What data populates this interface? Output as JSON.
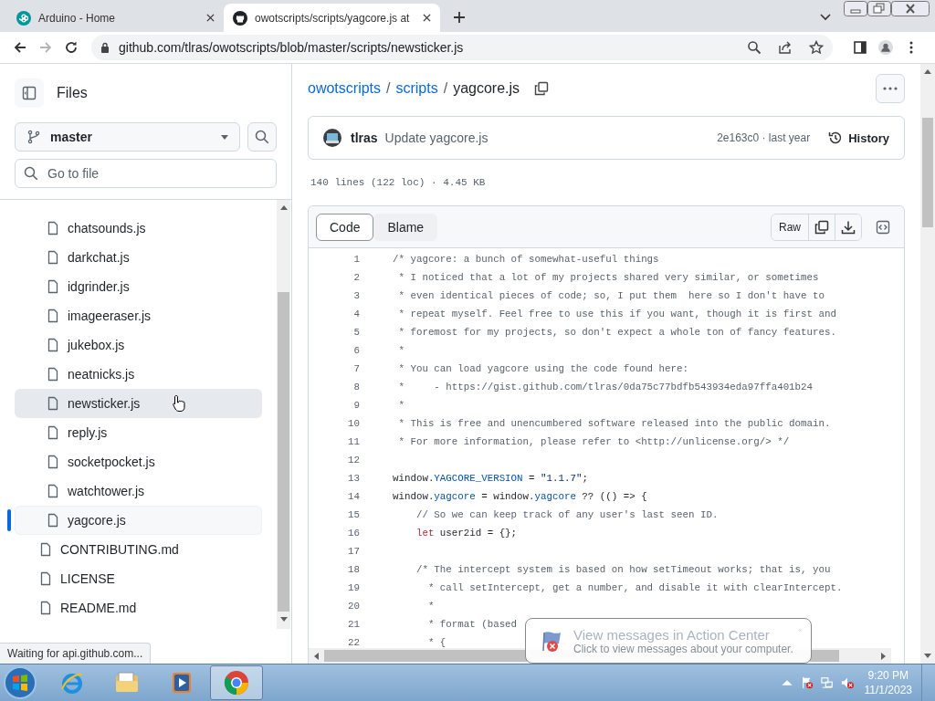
{
  "browser_tabs": [
    {
      "title": "Arduino - Home",
      "kind": "arduino",
      "selected": false
    },
    {
      "title": "owotscripts/scripts/yagcore.js at",
      "kind": "github",
      "selected": true
    }
  ],
  "address_bar": {
    "url": "github.com/tlras/owotscripts/blob/master/scripts/newsticker.js",
    "forward_disabled": true
  },
  "sidebar": {
    "title": "Files",
    "branch": "master",
    "search_placeholder": "Go to file",
    "file_tree": [
      {
        "children": [
          {
            "name": "chatsounds.js",
            "selected": false,
            "hovered": false
          },
          {
            "name": "darkchat.js",
            "selected": false,
            "hovered": false
          },
          {
            "name": "idgrinder.js",
            "selected": false,
            "hovered": false
          },
          {
            "name": "imageeraser.js",
            "selected": false,
            "hovered": false
          },
          {
            "name": "jukebox.js",
            "selected": false,
            "hovered": false
          },
          {
            "name": "neatnicks.js",
            "selected": false,
            "hovered": false
          },
          {
            "name": "newsticker.js",
            "selected": false,
            "hovered": true
          },
          {
            "name": "reply.js",
            "selected": false,
            "hovered": false
          },
          {
            "name": "socketpocket.js",
            "selected": false,
            "hovered": false
          },
          {
            "name": "watchtower.js",
            "selected": false,
            "hovered": false
          },
          {
            "name": "yagcore.js",
            "selected": true,
            "hovered": false
          }
        ]
      },
      {
        "name": "CONTRIBUTING.md",
        "selected": false,
        "hovered": false
      },
      {
        "name": "LICENSE",
        "selected": false,
        "hovered": false
      },
      {
        "name": "README.md",
        "selected": false,
        "hovered": false
      }
    ]
  },
  "breadcrumb": [
    {
      "text": "owotscripts",
      "kind": "link"
    },
    {
      "text": "/",
      "kind": "separator"
    },
    {
      "text": "scripts",
      "kind": "link"
    },
    {
      "text": "/",
      "kind": "separator"
    },
    {
      "text": "yagcore.js",
      "kind": "current"
    }
  ],
  "commit": {
    "author": "tlras",
    "message": "Update yagcore.js",
    "meta": "2e163c0 · last year",
    "history_label": "History"
  },
  "file_info": "140 lines (122 loc) · 4.45 KB",
  "view_tabs": [
    {
      "label": "Code",
      "selected": true
    },
    {
      "label": "Blame",
      "selected": false
    }
  ],
  "raw_label": "Raw",
  "code_lines": [
    {
      "number": "1",
      "segments": [
        {
          "text": "/* yagcore: a bunch of somewhat-useful things",
          "kind": "comment"
        }
      ]
    },
    {
      "number": "2",
      "segments": [
        {
          "text": " * I noticed that a lot of my projects shared very similar, or sometimes",
          "kind": "comment"
        }
      ]
    },
    {
      "number": "3",
      "segments": [
        {
          "text": " * even identical pieces of code; so, I put them  here so I don't have to",
          "kind": "comment"
        }
      ]
    },
    {
      "number": "4",
      "segments": [
        {
          "text": " * repeat myself. Feel free to use this if you want, though it is first and",
          "kind": "comment"
        }
      ]
    },
    {
      "number": "5",
      "segments": [
        {
          "text": " * foremost for my projects, so don't expect a whole ton of fancy features.",
          "kind": "comment"
        }
      ]
    },
    {
      "number": "6",
      "segments": [
        {
          "text": " *",
          "kind": "comment"
        }
      ]
    },
    {
      "number": "7",
      "segments": [
        {
          "text": " * You can load yagcore using the code found here:",
          "kind": "comment"
        }
      ]
    },
    {
      "number": "8",
      "segments": [
        {
          "text": " *     - https://gist.github.com/tlras/0da75c77bdfb543934eda97ffa401b24",
          "kind": "comment"
        }
      ]
    },
    {
      "number": "9",
      "segments": [
        {
          "text": " *",
          "kind": "comment"
        }
      ]
    },
    {
      "number": "10",
      "segments": [
        {
          "text": " * This is free and unencumbered software released into the public domain.",
          "kind": "comment"
        }
      ]
    },
    {
      "number": "11",
      "segments": [
        {
          "text": " * For more information, please refer to <http://unlicense.org/> */",
          "kind": "comment"
        }
      ]
    },
    {
      "number": "12"
    },
    {
      "number": "13",
      "segments": [
        {
          "text": "window.",
          "kind": "plain"
        },
        {
          "text": "YAGCORE_VERSION",
          "kind": "constant"
        },
        {
          "text": " = ",
          "kind": "plain"
        },
        {
          "text": "\"1.1.7\"",
          "kind": "string"
        },
        {
          "text": ";",
          "kind": "plain"
        }
      ]
    },
    {
      "number": "14",
      "segments": [
        {
          "text": "window.",
          "kind": "plain"
        },
        {
          "text": "yagcore",
          "kind": "constant"
        },
        {
          "text": " = window.",
          "kind": "plain"
        },
        {
          "text": "yagcore",
          "kind": "constant"
        },
        {
          "text": " ?? (() => {",
          "kind": "plain"
        }
      ]
    },
    {
      "number": "15",
      "segments": [
        {
          "text": "    // So we can keep track of any user's last seen ID.",
          "kind": "comment"
        }
      ]
    },
    {
      "number": "16",
      "segments": [
        {
          "text": "    let",
          "kind": "keyword"
        },
        {
          "text": " user2id = {};",
          "kind": "plain"
        }
      ]
    },
    {
      "number": "17"
    },
    {
      "number": "18",
      "segments": [
        {
          "text": "    /* The intercept system is based on how setTimeout works; that is, you",
          "kind": "comment"
        }
      ]
    },
    {
      "number": "19",
      "segments": [
        {
          "text": "      * call setIntercept, get a number, and disable it with clearIntercept.",
          "kind": "comment"
        }
      ]
    },
    {
      "number": "20",
      "segments": [
        {
          "text": "      *",
          "kind": "comment"
        }
      ]
    },
    {
      "number": "21",
      "segments": [
        {
          "text": "      * format (based",
          "kind": "comment"
        }
      ]
    },
    {
      "number": "22",
      "segments": [
        {
          "text": "      * {",
          "kind": "comment"
        }
      ]
    }
  ],
  "status_text": "Waiting for api.github.com...",
  "notification": {
    "title": "View messages in Action Center",
    "body": "Click to view messages about your computer."
  },
  "taskbar": {
    "apps": [
      {
        "kind": "ie",
        "active": false
      },
      {
        "kind": "explorer",
        "active": false
      },
      {
        "kind": "media",
        "active": false
      },
      {
        "kind": "chrome",
        "active": true
      }
    ],
    "time": "9:20 PM",
    "date": "11/1/2023"
  }
}
